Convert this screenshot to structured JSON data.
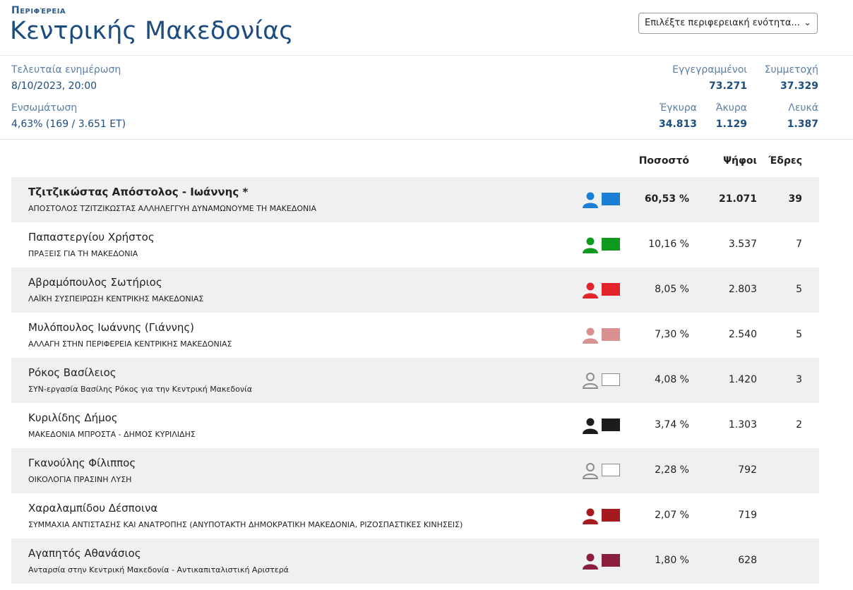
{
  "header": {
    "region_label": "Περιφέρεια",
    "region_title": "Κεντρικής Μακεδονίας",
    "select_placeholder": "Επιλέξτε περιφερειακή ενότητα..."
  },
  "info": {
    "last_update_label": "Τελευταία ενημέρωση",
    "last_update_value": "8/10/2023, 20:00",
    "integration_label": "Ενσωμάτωση",
    "integration_value": "4,63% (169 / 3.651 ΕΤ)",
    "registered_label": "Εγγεγραμμένοι",
    "registered_value": "73.271",
    "participation_label": "Συμμετοχή",
    "participation_value": "37.329",
    "valid_label": "Έγκυρα",
    "valid_value": "34.813",
    "invalid_label": "Άκυρα",
    "invalid_value": "1.129",
    "blank_label": "Λευκά",
    "blank_value": "1.387"
  },
  "table": {
    "col_pct": "Ποσοστό",
    "col_votes": "Ψήφοι",
    "col_seats": "Έδρες",
    "rows": [
      {
        "name": "Τζιτζικώστας Απόστολος - Ιωάννης *",
        "party": "ΑΠΟΣΤΟΛΟΣ ΤΖΙΤΖΙΚΩΣΤΑΣ ΑΛΛΗΛΕΓΓΥΗ ΔΥΝΑΜΩΝΟΥΜΕ ΤΗ ΜΑΚΕΔΟΝΙΑ",
        "pct": "60,53 %",
        "votes": "21.071",
        "seats": "39",
        "color": "#1a7fd4"
      },
      {
        "name": "Παπαστεργίου Χρήστος",
        "party": "ΠΡΑΞΕΙΣ ΓΙΑ ΤΗ ΜΑΚΕΔΟΝΙΑ",
        "pct": "10,16 %",
        "votes": "3.537",
        "seats": "7",
        "color": "#0f9a1f"
      },
      {
        "name": "Αβραμόπουλος Σωτήριος",
        "party": "ΛΑΪΚΗ ΣΥΣΠΕΙΡΩΣΗ ΚΕΝΤΡΙΚΗΣ ΜΑΚΕΔΟΝΙΑΣ",
        "pct": "8,05 %",
        "votes": "2.803",
        "seats": "5",
        "color": "#e3242b"
      },
      {
        "name": "Μυλόπουλος Ιωάννης (Γιάννης)",
        "party": "ΑΛΛΑΓΗ ΣΤΗΝ ΠΕΡΙΦΕΡΕΙΑ ΚΕΝΤΡΙΚΗΣ ΜΑΚΕΔΟΝΙΑΣ",
        "pct": "7,30 %",
        "votes": "2.540",
        "seats": "5",
        "color": "#d99090"
      },
      {
        "name": "Ρόκος Βασίλειος",
        "party": "ΣΥΝ-εργασία Βασίλης Ρόκος για την Κεντρική Μακεδονία",
        "pct": "4,08 %",
        "votes": "1.420",
        "seats": "3",
        "color": "#ffffff"
      },
      {
        "name": "Κυριλίδης Δήμος",
        "party": "ΜΑΚΕΔΟΝΙΑ ΜΠΡΟΣΤΑ - ΔΗΜΟΣ ΚΥΡΙΛΙΔΗΣ",
        "pct": "3,74 %",
        "votes": "1.303",
        "seats": "2",
        "color": "#1c1c1c"
      },
      {
        "name": "Γκανούλης Φίλιππος",
        "party": "ΟΙΚΟΛΟΓΙΑ ΠΡΑΣΙΝΗ ΛΥΣΗ",
        "pct": "2,28 %",
        "votes": "792",
        "seats": "",
        "color": "#ffffff"
      },
      {
        "name": "Χαραλαμπίδου Δέσποινα",
        "party": "ΣΥΜΜΑΧΙΑ ΑΝΤΙΣΤΑΣΗΣ ΚΑΙ ΑΝΑΤΡΟΠΗΣ (ΑΝΥΠΟΤΑΚΤΗ ΔΗΜΟΚΡΑΤΙΚΗ ΜΑΚΕΔΟΝΙΑ, ΡΙΖΟΣΠΑΣΤΙΚΕΣ ΚΙΝΗΣΕΙΣ)",
        "pct": "2,07 %",
        "votes": "719",
        "seats": "",
        "color": "#a51a1f"
      },
      {
        "name": "Αγαπητός Αθανάσιος",
        "party": "Ανταρσία στην Κεντρική Μακεδονία - Αντικαπιταλιστική Αριστερά",
        "pct": "1,80 %",
        "votes": "628",
        "seats": "",
        "color": "#8a1f3e"
      }
    ]
  }
}
